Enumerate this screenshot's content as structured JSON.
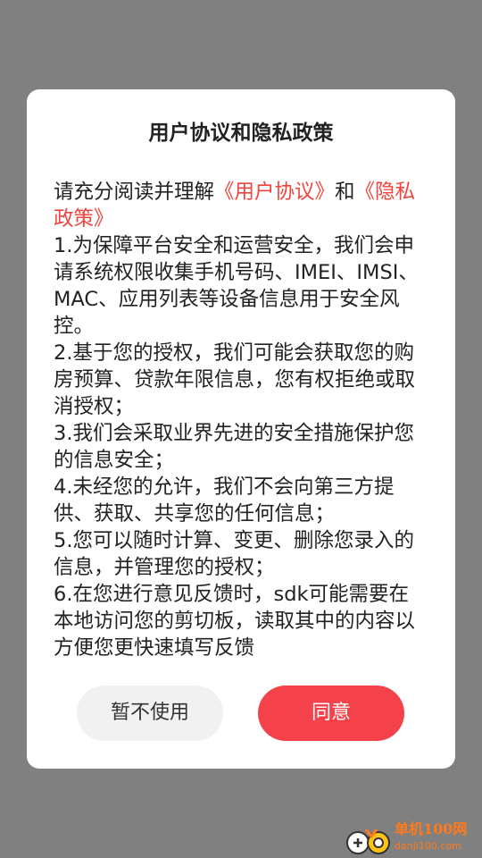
{
  "dialog": {
    "title": "用户协议和隐私政策",
    "intro_prefix": "请充分阅读并理解",
    "link_user_agreement": "《用户协议》",
    "intro_and": "和",
    "link_privacy_policy": "《隐私政策》",
    "items": [
      "1.为保障平台安全和运营安全，我们会申请系统权限收集手机号码、IMEI、IMSI、MAC、应用列表等设备信息用于安全风控。",
      "2.基于您的授权，我们可能会获取您的购房预算、贷款年限信息，您有权拒绝或取消授权；",
      "3.我们会采取业界先进的安全措施保护您的信息安全；",
      "4.未经您的允许，我们不会向第三方提供、获取、共享您的任何信息；",
      "5.您可以随时计算、变更、删除您录入的信息，并管理您的授权；",
      "6.在您进行意见反馈时，sdk可能需要在本地访问您的剪切板，读取其中的内容以方便您更快速填写反馈"
    ],
    "decline_label": "暂不使用",
    "agree_label": "同意"
  },
  "watermark": {
    "name": "单机100网",
    "url": "danji100.com"
  },
  "colors": {
    "accent": "#f5424a",
    "link": "#f0443e",
    "overlay": "#808080",
    "watermark": "#ff7a1c"
  }
}
